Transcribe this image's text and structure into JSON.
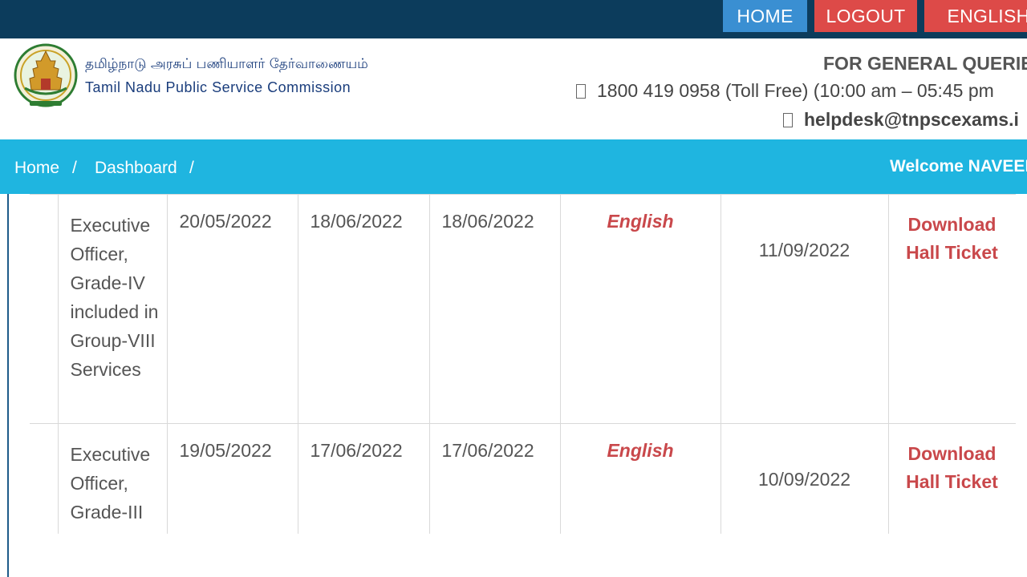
{
  "topnav": {
    "home": "HOME",
    "logout": "LOGOUT",
    "english": "ENGLISH"
  },
  "header": {
    "org_tamil": "தமிழ்நாடு அரசுப் பணியாளர் தேர்வாணையம்",
    "org_english": "Tamil Nadu Public Service Commission",
    "queries_title": "FOR GENERAL QUERIE",
    "phone_text": "1800 419 0958 (Toll Free)  (10:00 am – 05:45 pm",
    "email_text": "helpdesk@tnpscexams.i",
    "emblem_icon": "tn-government-emblem-icon",
    "phone_icon": "phone-icon",
    "email_icon": "envelope-icon"
  },
  "breadcrumb": {
    "items": [
      "Home",
      "Dashboard"
    ],
    "separator": "/",
    "welcome": "Welcome NAVEEN"
  },
  "table": {
    "rows": [
      {
        "post": "Executive Officer, Grade-IV included in Group-VIII Services",
        "date1": "20/05/2022",
        "date2": "18/06/2022",
        "date3": "18/06/2022",
        "language": "English",
        "exam_date": "11/09/2022",
        "action": "Download Hall Ticket"
      },
      {
        "post": "Executive Officer, Grade-III",
        "date1": "19/05/2022",
        "date2": "17/06/2022",
        "date3": "17/06/2022",
        "language": "English",
        "exam_date": "10/09/2022",
        "action": "Download Hall Ticket"
      }
    ]
  },
  "colors": {
    "topbar": "#0c3c5c",
    "home_button": "#3a8fd2",
    "red_button": "#dd4a48",
    "breadcrumb_bar": "#1fb5e0",
    "link_red": "#c9484b",
    "org_blue": "#1a3d7c"
  }
}
